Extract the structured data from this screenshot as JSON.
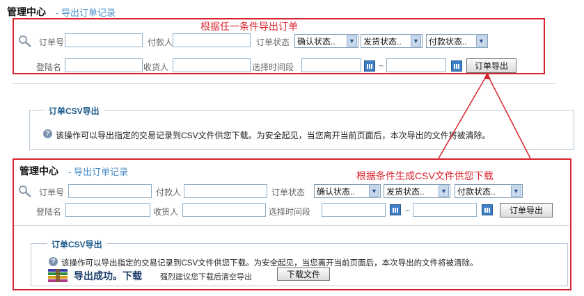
{
  "top": {
    "title_main": "管理中心",
    "title_sub": "- 导出订单记录",
    "annotation": "根据任一条件导出订单",
    "filters": {
      "order_no_label": "订单号",
      "payer_label": "付款人",
      "order_status_label": "订单状态",
      "confirm_status": "确认状态..",
      "ship_status": "发货状态..",
      "pay_status": "付款状态..",
      "login_label": "登陆名",
      "receiver_label": "收货人",
      "time_range_label": "选择时间段",
      "tilde": "~",
      "export_button": "订单导出"
    },
    "fieldset": {
      "legend": "订单CSV导出",
      "info": "该操作可以导出指定的交易记录到CSV文件供您下载。为安全起见，当您离开当前页面后，本次导出的文件将被清除。"
    }
  },
  "bottom": {
    "title_main": "管理中心",
    "title_sub": "- 导出订单记录",
    "annotation": "根据条件生成CSV文件供您下载",
    "filters": {
      "order_no_label": "订单号",
      "payer_label": "付款人",
      "order_status_label": "订单状态",
      "confirm_status": "确认状态..",
      "ship_status": "发货状态..",
      "pay_status": "付款状态..",
      "login_label": "登陆名",
      "receiver_label": "收货人",
      "time_range_label": "选择时间段",
      "tilde": "~",
      "export_button": "订单导出"
    },
    "fieldset": {
      "legend": "订单CSV导出",
      "info": "该操作可以导出指定的交易记录到CSV文件供您下载。为安全起见，当您离开当前页面后，本次导出的文件将被清除。",
      "success_text": "导出成功。下载",
      "suggest_text": "强烈建议您下载后清空导出",
      "download_button": "下载文件"
    }
  },
  "colors": {
    "annotation_red": "#d9232c",
    "title_blue": "#4a8fc9",
    "legend_blue": "#1c5a8a"
  }
}
